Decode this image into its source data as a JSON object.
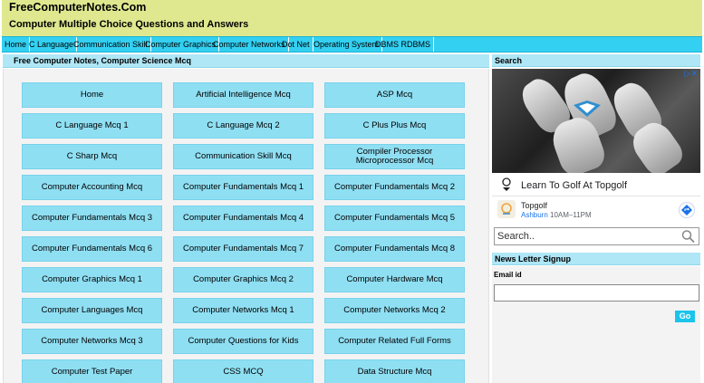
{
  "header": {
    "site_title": "FreeComputerNotes.Com",
    "tagline": "Computer Multiple Choice Questions and Answers",
    "background": "#dfe88f"
  },
  "nav": {
    "background": "#33d0f2",
    "items": [
      {
        "label": "Home"
      },
      {
        "label": "C Language"
      },
      {
        "label": "Communication Skill"
      },
      {
        "label": "Computer Graphics"
      },
      {
        "label": "Computer Networks"
      },
      {
        "label": "Dot Net"
      },
      {
        "label": "Operating System"
      },
      {
        "label": "DBMS RDBMS"
      }
    ]
  },
  "content": {
    "title": "Free Computer Notes, Computer Science Mcq",
    "tile_color": "#8fdff3",
    "tiles": [
      {
        "label": "Home"
      },
      {
        "label": "Artificial Intelligence Mcq"
      },
      {
        "label": "ASP Mcq"
      },
      {
        "label": "C Language Mcq 1"
      },
      {
        "label": "C Language Mcq 2"
      },
      {
        "label": "C Plus Plus Mcq"
      },
      {
        "label": "C Sharp Mcq"
      },
      {
        "label": "Communication Skill Mcq"
      },
      {
        "label": "Compiler Processor Microprocessor Mcq"
      },
      {
        "label": "Computer Accounting Mcq"
      },
      {
        "label": "Computer Fundamentals Mcq 1"
      },
      {
        "label": "Computer Fundamentals Mcq 2"
      },
      {
        "label": "Computer Fundamentals Mcq 3"
      },
      {
        "label": "Computer Fundamentals Mcq 4"
      },
      {
        "label": "Computer Fundamentals Mcq 5"
      },
      {
        "label": "Computer Fundamentals Mcq 6"
      },
      {
        "label": "Computer Fundamentals Mcq 7"
      },
      {
        "label": "Computer Fundamentals Mcq 8"
      },
      {
        "label": "Computer Graphics Mcq 1"
      },
      {
        "label": "Computer Graphics Mcq 2"
      },
      {
        "label": "Computer Hardware Mcq"
      },
      {
        "label": "Computer Languages Mcq"
      },
      {
        "label": "Computer Networks Mcq 1"
      },
      {
        "label": "Computer Networks Mcq 2"
      },
      {
        "label": "Computer Networks Mcq 3"
      },
      {
        "label": "Computer Questions for Kids"
      },
      {
        "label": "Computer Related Full Forms"
      },
      {
        "label": "Computer Test Paper"
      },
      {
        "label": "CSS MCQ"
      },
      {
        "label": "Data Structure Mcq"
      }
    ]
  },
  "sidebar": {
    "search_heading": "Search",
    "ad": {
      "headline": "Learn To Golf At Topgolf",
      "brand": "Topgolf",
      "city": "Ashburn",
      "hours": "10AM–11PM",
      "info_icon": "ad-choices-icon"
    },
    "search": {
      "placeholder": "Search..",
      "icon": "search-icon"
    },
    "newsletter_heading": "News Letter Signup",
    "email_label": "Email id",
    "go_label": "Go"
  }
}
